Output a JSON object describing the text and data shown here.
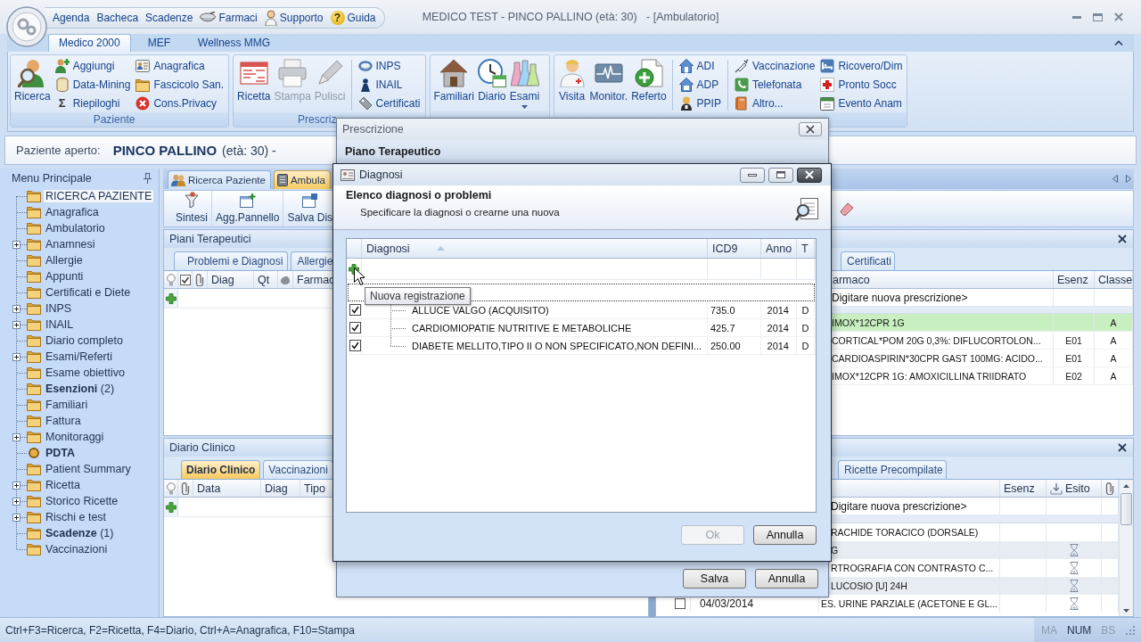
{
  "window": {
    "title": "MEDICO TEST - PINCO PALLINO (età: 30)   - [Ambulatorio]"
  },
  "quick_access": [
    {
      "label": "Agenda"
    },
    {
      "label": "Bacheca"
    },
    {
      "label": "Scadenze"
    },
    {
      "label": "Farmaci"
    },
    {
      "label": "Supporto"
    },
    {
      "label": "Guida",
      "glyph": "?"
    }
  ],
  "ribbon_tabs": [
    {
      "label": "Medico 2000",
      "selected": true
    },
    {
      "label": "MEF",
      "selected": false
    },
    {
      "label": "Wellness MMG",
      "selected": false
    }
  ],
  "ribbon_groups": [
    {
      "label": "Paziente",
      "columns": [
        {
          "kind": "large",
          "items": [
            {
              "label": "Ricerca",
              "disabled": false
            }
          ]
        },
        {
          "kind": "small",
          "items": [
            {
              "label": "Aggiungi",
              "disabled": false
            },
            {
              "label": "Data-Mining",
              "disabled": false
            },
            {
              "label": "Riepiloghi",
              "disabled": false,
              "glyph": "Σ"
            }
          ]
        },
        {
          "kind": "small",
          "items": [
            {
              "label": "Anagrafica",
              "disabled": false
            },
            {
              "label": "Fascicolo San.",
              "disabled": false
            },
            {
              "label": "Cons.Privacy",
              "disabled": false
            }
          ]
        }
      ]
    },
    {
      "label": "Prescriz",
      "columns": [
        {
          "kind": "large",
          "items": [
            {
              "label": "Ricetta",
              "disabled": false
            }
          ]
        },
        {
          "kind": "large",
          "items": [
            {
              "label": "Stampa",
              "disabled": true
            }
          ]
        },
        {
          "kind": "large",
          "items": [
            {
              "label": "Pulisci",
              "disabled": true
            }
          ]
        },
        {
          "kind": "small",
          "divider": true,
          "items": [
            {
              "label": "INPS",
              "disabled": false
            },
            {
              "label": "INAIL",
              "disabled": false
            },
            {
              "label": "Certificati",
              "disabled": false
            }
          ]
        }
      ]
    },
    {
      "columns": [
        {
          "kind": "large",
          "items": [
            {
              "label": "Familiari",
              "disabled": false
            }
          ]
        },
        {
          "kind": "large",
          "items": [
            {
              "label": "Diario",
              "disabled": false
            }
          ]
        },
        {
          "kind": "large",
          "items": [
            {
              "label": "Esami",
              "disabled": false,
              "dropdown": true
            }
          ]
        }
      ]
    },
    {
      "columns": [
        {
          "kind": "large",
          "items": [
            {
              "label": "Visita",
              "disabled": false
            }
          ]
        },
        {
          "kind": "large",
          "items": [
            {
              "label": "Monitor.",
              "disabled": false
            }
          ]
        },
        {
          "kind": "large",
          "items": [
            {
              "label": "Referto",
              "disabled": false
            }
          ]
        },
        {
          "kind": "small",
          "divider": true,
          "items": [
            {
              "label": "ADI",
              "disabled": false
            },
            {
              "label": "ADP",
              "disabled": false
            },
            {
              "label": "PPIP",
              "disabled": false
            }
          ]
        },
        {
          "kind": "small",
          "divider": true,
          "items": [
            {
              "label": "Vaccinazione",
              "disabled": false
            },
            {
              "label": "Telefonata",
              "disabled": false
            },
            {
              "label": "Altro...",
              "disabled": false
            }
          ]
        },
        {
          "kind": "small",
          "items": [
            {
              "label": "Ricovero/Dim",
              "disabled": false
            },
            {
              "label": "Pronto Socc",
              "disabled": false
            },
            {
              "label": "Evento Anam",
              "disabled": false
            }
          ]
        }
      ]
    }
  ],
  "patient": {
    "label": "Paziente aperto:",
    "name": "PINCO PALLINO",
    "details": "(età: 30) -"
  },
  "sidebar": {
    "title": "Menu Principale",
    "items": [
      {
        "label": "RICERCA PAZIENTE",
        "kind": "folder",
        "selected": true,
        "collapsed": false,
        "bold": false
      },
      {
        "label": "Anagrafica",
        "kind": "folder",
        "selected": false,
        "collapsed": false,
        "bold": false
      },
      {
        "label": "Ambulatorio",
        "kind": "folder",
        "selected": false,
        "collapsed": false,
        "bold": false
      },
      {
        "label": "Anamnesi",
        "kind": "folder",
        "selected": false,
        "collapsed": true,
        "bold": false
      },
      {
        "label": "Allergie",
        "kind": "folder",
        "selected": false,
        "collapsed": false,
        "bold": false
      },
      {
        "label": "Appunti",
        "kind": "folder",
        "selected": false,
        "collapsed": false,
        "bold": false
      },
      {
        "label": "Certificati e Diete",
        "kind": "folder",
        "selected": false,
        "collapsed": false,
        "bold": false
      },
      {
        "label": "INPS",
        "kind": "folder",
        "selected": false,
        "collapsed": true,
        "bold": false
      },
      {
        "label": "INAIL",
        "kind": "folder",
        "selected": false,
        "collapsed": true,
        "bold": false
      },
      {
        "label": "Diario completo",
        "kind": "folder",
        "selected": false,
        "collapsed": false,
        "bold": false
      },
      {
        "label": "Esami/Referti",
        "kind": "folder",
        "selected": false,
        "collapsed": true,
        "bold": false
      },
      {
        "label": "Esame obiettivo",
        "kind": "folder",
        "selected": false,
        "collapsed": false,
        "bold": false
      },
      {
        "label": "Esenzioni",
        "count": "(2)",
        "kind": "folder",
        "selected": false,
        "collapsed": false,
        "bold": true
      },
      {
        "label": "Familiari",
        "kind": "folder",
        "selected": false,
        "collapsed": false,
        "bold": false
      },
      {
        "label": "Fattura",
        "kind": "folder",
        "selected": false,
        "collapsed": false,
        "bold": false
      },
      {
        "label": "Monitoraggi",
        "kind": "folder",
        "selected": false,
        "collapsed": true,
        "bold": false
      },
      {
        "label": "PDTA",
        "kind": "process",
        "selected": false,
        "collapsed": false,
        "bold": true
      },
      {
        "label": "Patient Summary",
        "kind": "folder",
        "selected": false,
        "collapsed": false,
        "bold": false
      },
      {
        "label": "Ricetta",
        "kind": "folder",
        "selected": false,
        "collapsed": true,
        "bold": false
      },
      {
        "label": "Storico Ricette",
        "kind": "folder",
        "selected": false,
        "collapsed": true,
        "bold": false
      },
      {
        "label": "Rischi e test",
        "kind": "folder",
        "selected": false,
        "collapsed": true,
        "bold": false
      },
      {
        "label": "Scadenze",
        "count": "(1)",
        "kind": "folder",
        "selected": false,
        "collapsed": false,
        "bold": true
      },
      {
        "label": "Vaccinazioni",
        "kind": "folder",
        "selected": false,
        "collapsed": false,
        "bold": false
      }
    ]
  },
  "main": {
    "doc_tabs": [
      {
        "label": "Ricerca Paziente",
        "selected": false
      },
      {
        "label": "Ambula",
        "selected": true
      }
    ],
    "toolbar": [
      {
        "label": "Sintesi"
      },
      {
        "label": "Agg.Pannello"
      },
      {
        "label": "Salva Dis"
      }
    ],
    "piani_terapeutici": {
      "title": "Piani Terapeutici",
      "tabs_left": [
        {
          "label": "Problemi e Diagnosi",
          "selected": false
        },
        {
          "label": "Allergie",
          "selected": false
        }
      ],
      "tabs_right": [
        {
          "label": "Certificati",
          "selected": false
        }
      ],
      "columns_left": [
        "Diag",
        "Qt",
        "Farmac"
      ],
      "columns_right": [
        "armaco",
        "Esenz",
        "Classe"
      ],
      "new_row": "Digitare nuova prescrizione>",
      "rows": [
        {
          "farmaco": "IMOX*12CPR 1G",
          "classe": "A",
          "selected": true
        },
        {
          "farmaco": "CORTICAL*POM 20G 0,3%: DIFLUCORTOLON...",
          "esenz": "E01",
          "classe": "A",
          "selected": false
        },
        {
          "farmaco": "CARDIOASPIRIN*30CPR GAST 100MG: ACIDO...",
          "esenz": "E01",
          "classe": "A",
          "selected": false
        },
        {
          "farmaco": "IMOX*12CPR 1G: AMOXICILLINA TRIIDRATO",
          "esenz": "E02",
          "classe": "A",
          "selected": false
        }
      ]
    },
    "diario_clinico": {
      "title": "Diario Clinico",
      "tabs": [
        {
          "label": "Diario Clinico",
          "selected": true
        },
        {
          "label": "Vaccinazioni",
          "selected": false
        }
      ],
      "columns": [
        "Data",
        "Diag",
        "Tipo"
      ]
    },
    "ricette": {
      "tabs": [
        {
          "label": "Ricette Precompilate",
          "selected": false
        }
      ],
      "columns": [
        "Esenz",
        "Esito"
      ],
      "new_row": "Digitare nuova prescrizione>",
      "rows": [
        {
          "description": "RACHIDE TORACICO (DORSALE)",
          "pending": false
        },
        {
          "description": "G",
          "pending": true
        },
        {
          "description": "RTROGRAFIA CON CONTRASTO C...",
          "pending": true
        },
        {
          "description": "LUCOSIO [U] 24H",
          "pending": true
        },
        {
          "checked": false,
          "date": "04/03/2014",
          "description": "ES. URINE PARZIALE (ACETONE E GL...",
          "pending": true
        }
      ]
    }
  },
  "prescrizione_dialog": {
    "title": "Prescrizione",
    "header": "Piano Terapeutico",
    "buttons": [
      {
        "label": "Salva",
        "disabled": false
      },
      {
        "label": "Annulla",
        "disabled": false
      }
    ]
  },
  "diagnosi_dialog": {
    "title": "Diagnosi",
    "heading": "Elenco diagnosi o problemi",
    "subheading": "Specificare la diagnosi o crearne una nuova",
    "columns": [
      "Diagnosi",
      "ICD9",
      "Anno",
      "T"
    ],
    "rows": [
      {
        "checked": true,
        "diagnosi": "ALLUCE VALGO (ACQUISITO)",
        "icd9": "735.0",
        "anno": "2014",
        "t": "D"
      },
      {
        "checked": true,
        "diagnosi": "CARDIOMIOPATIE NUTRITIVE E METABOLICHE",
        "icd9": "425.7",
        "anno": "2014",
        "t": "D"
      },
      {
        "checked": true,
        "diagnosi": "DIABETE MELLITO,TIPO II O NON SPECIFICATO,NON DEFINI...",
        "icd9": "250.00",
        "anno": "2014",
        "t": "D"
      }
    ],
    "tooltip": "Nuova registrazione",
    "buttons": [
      {
        "label": "Ok",
        "disabled": true
      },
      {
        "label": "Annulla",
        "disabled": false
      }
    ]
  },
  "status_bar": {
    "text": "Ctrl+F3=Ricerca, F2=Ricetta, F4=Diario, Ctrl+A=Anagrafica, F10=Stampa",
    "indicators": [
      {
        "label": "MA",
        "on": false
      },
      {
        "label": "NUM",
        "on": true
      },
      {
        "label": "BS",
        "on": false
      }
    ]
  }
}
